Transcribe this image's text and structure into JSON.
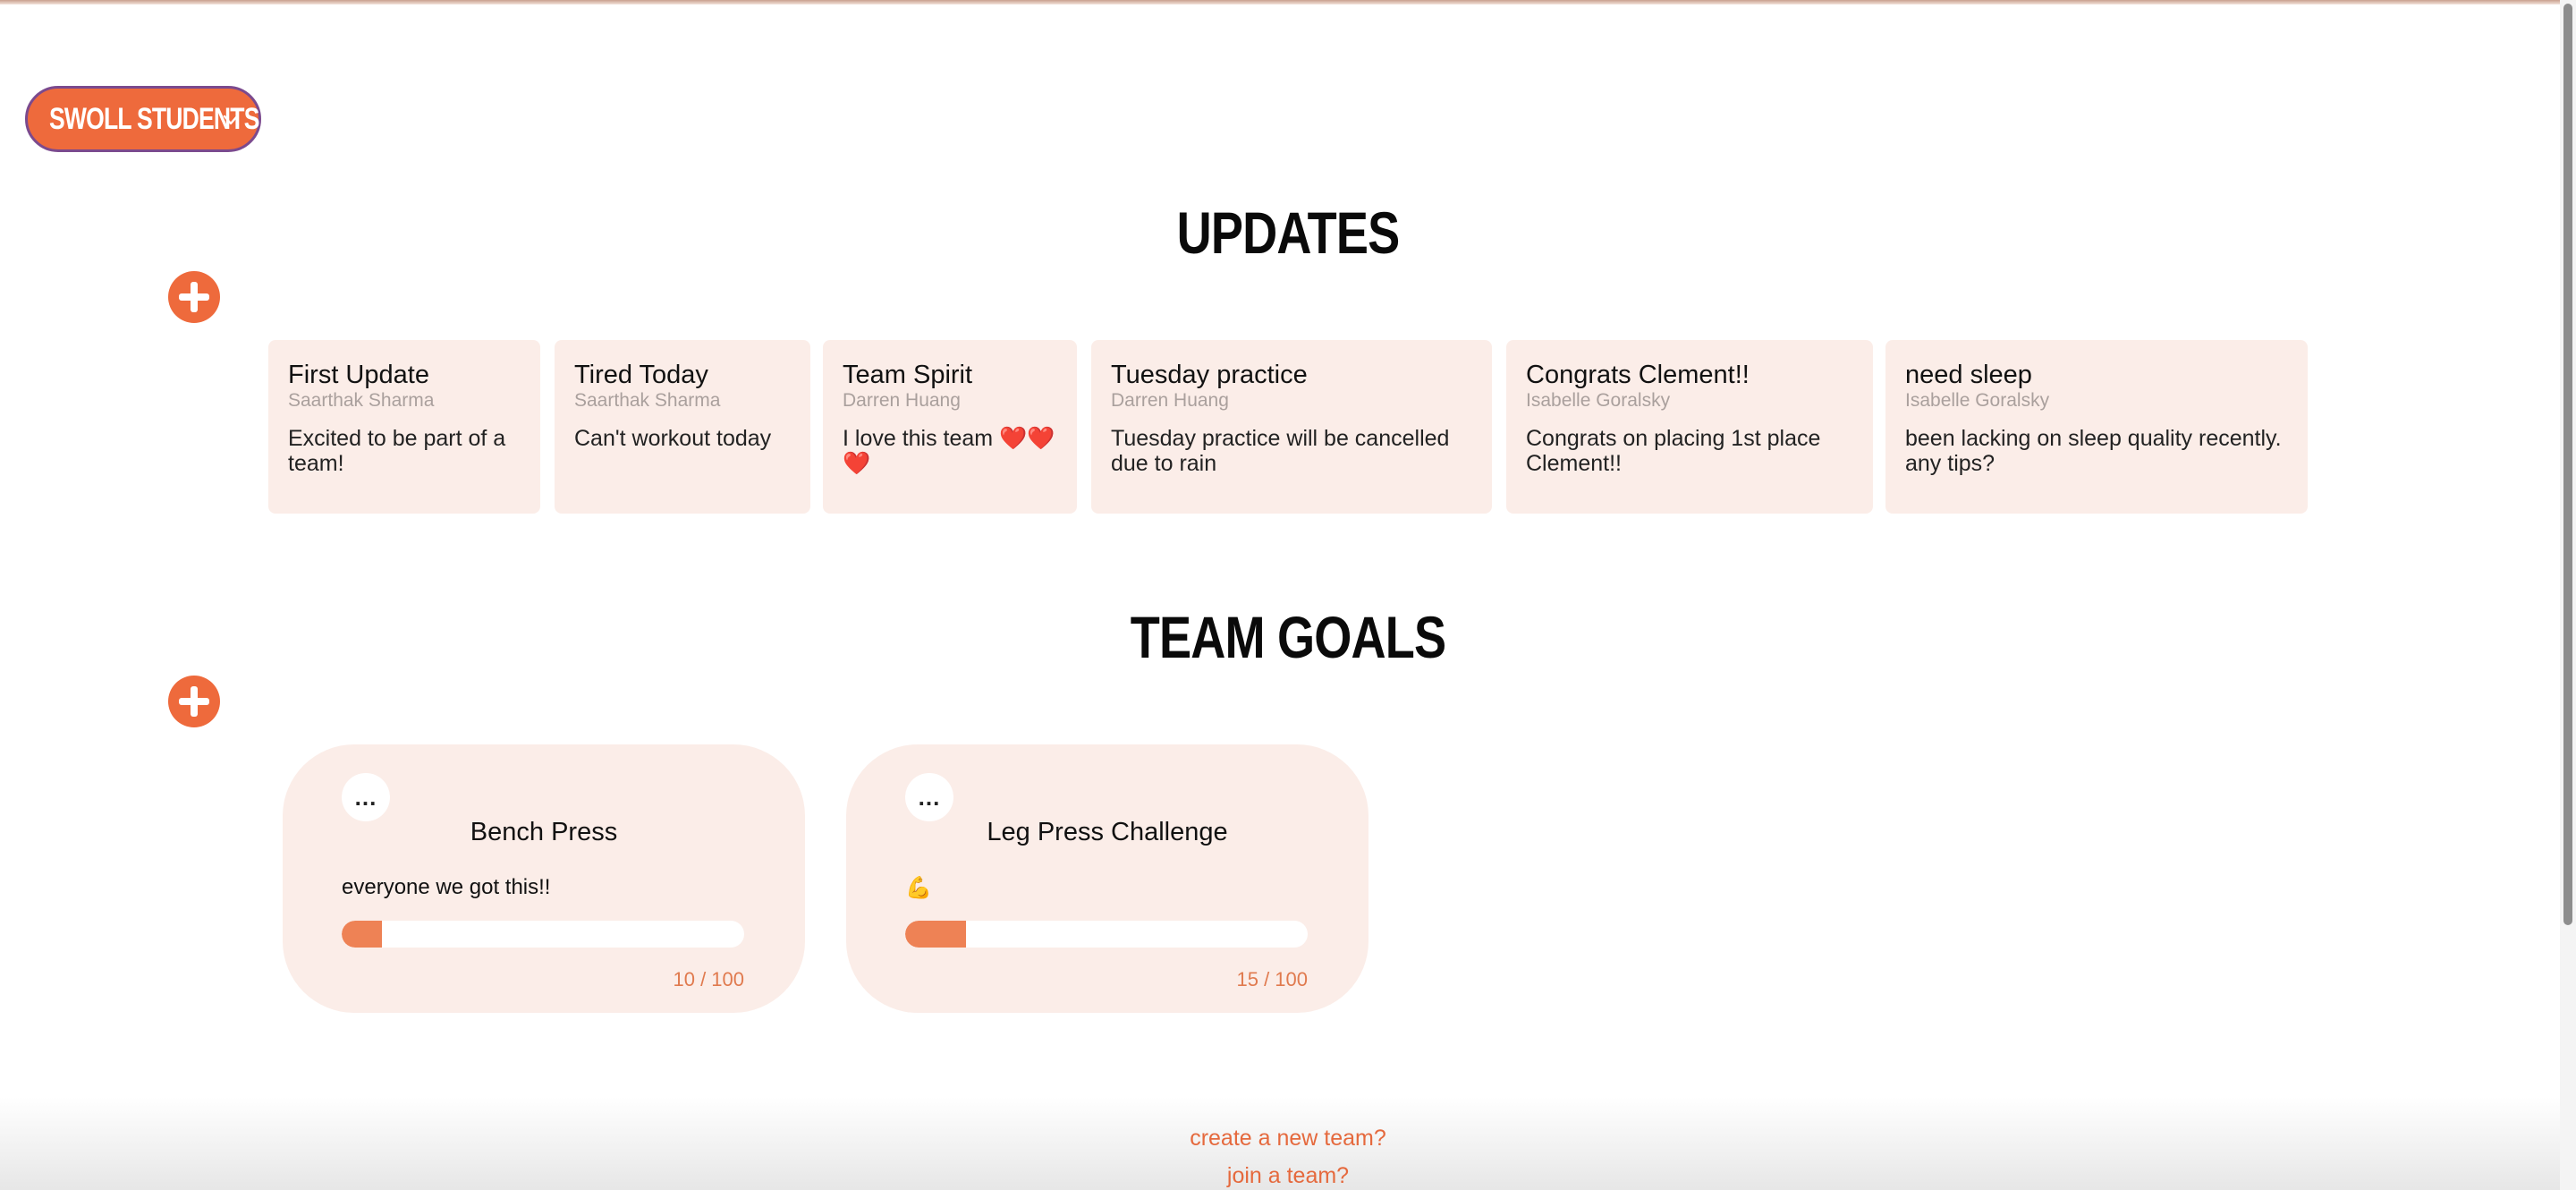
{
  "team_selector": {
    "label": "SWOLL STUDENTS",
    "icon": "chevron-down-icon"
  },
  "updates": {
    "title": "UPDATES",
    "add_icon": "plus-circle-icon",
    "items": [
      {
        "title": "First Update",
        "author": "Saarthak Sharma",
        "body": "Excited to be part of a team!"
      },
      {
        "title": "Tired Today",
        "author": "Saarthak Sharma",
        "body": "Can't workout today"
      },
      {
        "title": "Team Spirit",
        "author": "Darren Huang",
        "body": "I love this team ❤️❤️❤️"
      },
      {
        "title": "Tuesday practice",
        "author": "Darren Huang",
        "body": "Tuesday practice will be cancelled due to rain"
      },
      {
        "title": "Congrats Clement!!",
        "author": "Isabelle Goralsky",
        "body": "Congrats on placing 1st place Clement!!"
      },
      {
        "title": "need sleep",
        "author": "Isabelle Goralsky",
        "body": "been lacking on sleep quality recently. any tips?"
      }
    ]
  },
  "team_goals": {
    "title": "TEAM GOALS",
    "add_icon": "plus-circle-icon",
    "items": [
      {
        "more_label": "...",
        "title": "Bench Press",
        "description": "everyone we got this!!",
        "progress": 0.1,
        "count": "10 / 100"
      },
      {
        "more_label": "...",
        "title": "Leg Press Challenge",
        "description": "💪",
        "progress": 0.15,
        "count": "15 / 100"
      }
    ]
  },
  "footer": {
    "create_team": "create a new team?",
    "join_team": "join a team?"
  },
  "colors": {
    "accent": "#ee6a3c",
    "card_bg": "#fbede8",
    "progress_fill": "#ee8255"
  }
}
